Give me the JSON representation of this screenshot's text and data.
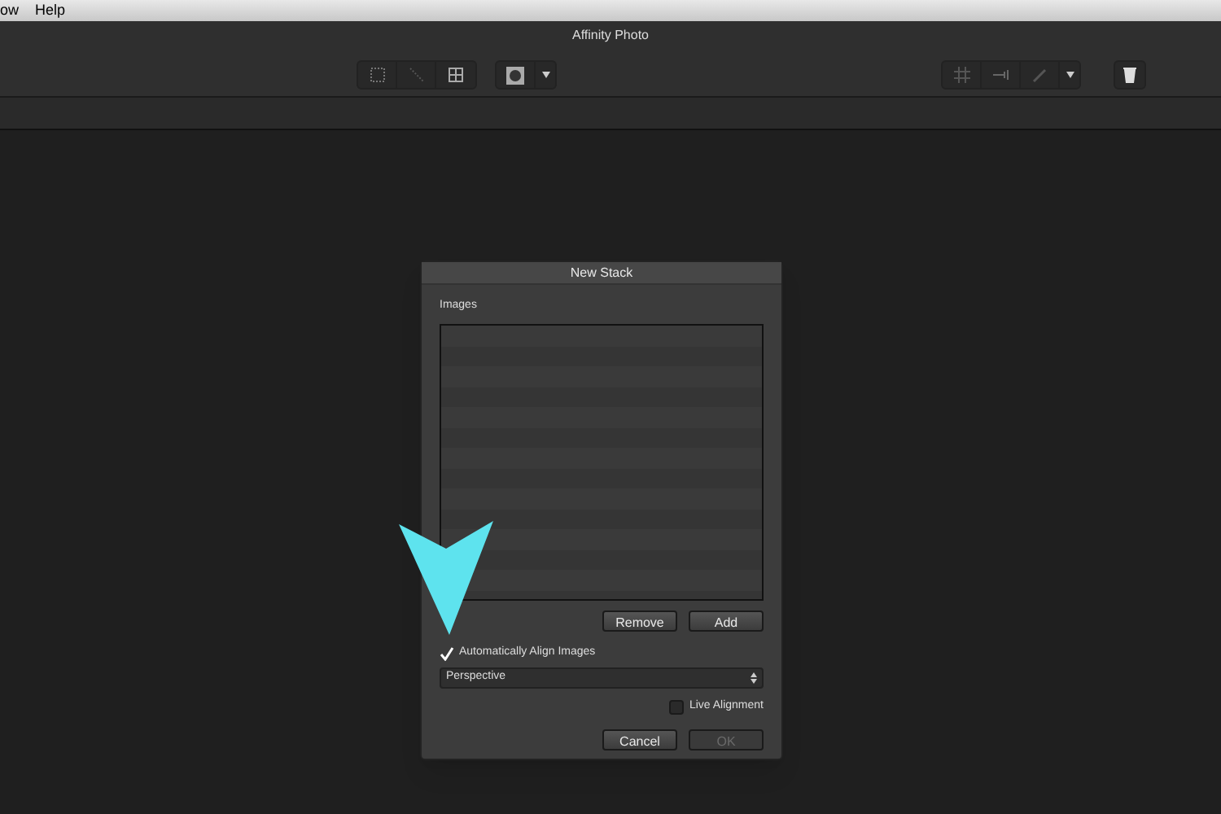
{
  "menu_bar": {
    "items": [
      "ow",
      "Help"
    ]
  },
  "window": {
    "title": "Affinity Photo"
  },
  "dialog": {
    "title": "New Stack",
    "images_label": "Images",
    "list_buttons": [
      {
        "label": "Remove",
        "disabled": false
      },
      {
        "label": "Add",
        "disabled": false
      }
    ],
    "align_checkbox": {
      "label": "Automatically Align Images",
      "checked": true
    },
    "alignment_select": {
      "value": "Perspective"
    },
    "live_alignment": {
      "label": "Live Alignment",
      "checked": false
    },
    "footer_buttons": [
      {
        "label": "Cancel",
        "disabled": false
      },
      {
        "label": "OK",
        "disabled": true
      }
    ]
  }
}
